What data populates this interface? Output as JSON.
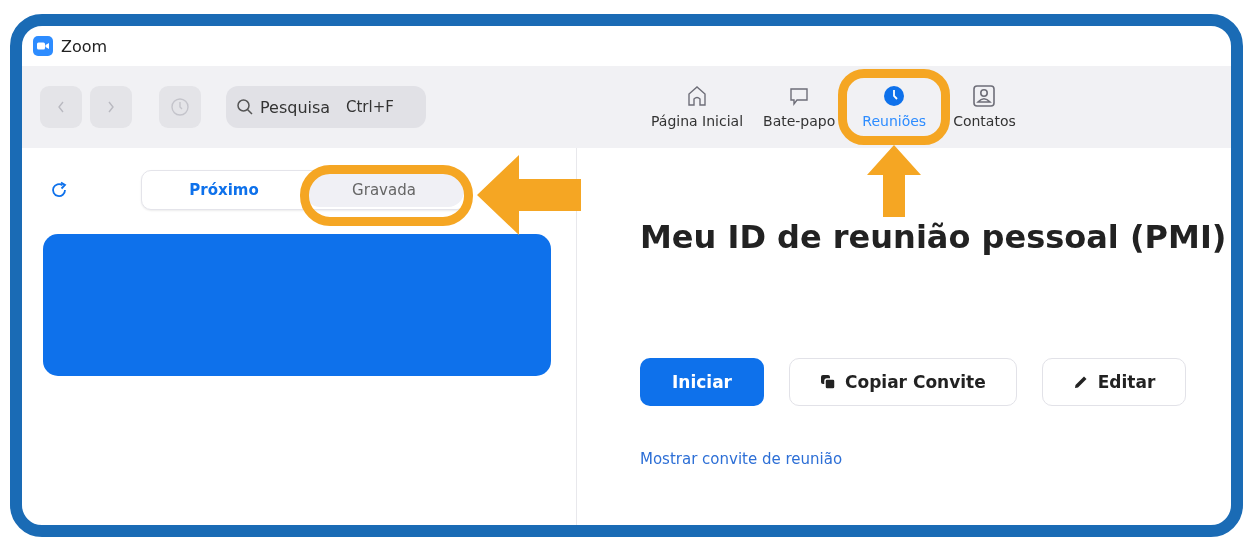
{
  "window": {
    "title": "Zoom"
  },
  "toolbar": {
    "search": {
      "placeholder": "Pesquisa",
      "shortcut": "Ctrl+F"
    }
  },
  "nav_tabs": [
    {
      "label": "Página Inicial",
      "selected": false
    },
    {
      "label": "Bate-papo",
      "selected": false
    },
    {
      "label": "Reuniões",
      "selected": true
    },
    {
      "label": "Contatos",
      "selected": false
    }
  ],
  "meetings_panel": {
    "segments": [
      {
        "label": "Próximo",
        "selected": true
      },
      {
        "label": "Gravada",
        "selected": false
      }
    ]
  },
  "personal_meeting": {
    "title": "Meu ID de reunião pessoal (PMI)",
    "buttons": [
      {
        "label": "Iniciar",
        "kind": "primary"
      },
      {
        "label": "Copiar Convite",
        "kind": "copy"
      },
      {
        "label": "Editar",
        "kind": "edit"
      }
    ],
    "link": "Mostrar convite de reunião"
  }
}
